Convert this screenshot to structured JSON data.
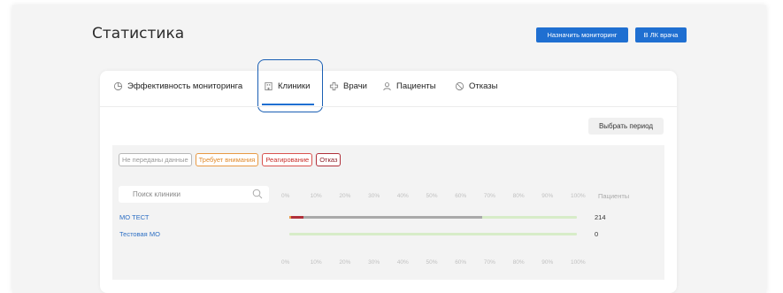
{
  "header": {
    "title": "Статистика",
    "assign_button": "Назначить мониторинг",
    "doctor_button": "В ЛК врача"
  },
  "tabs": [
    {
      "label": "Эффективность мониторинга",
      "icon": "chart-icon"
    },
    {
      "label": "Клиники",
      "icon": "building-icon",
      "active": true
    },
    {
      "label": "Врачи",
      "icon": "medical-cross-icon"
    },
    {
      "label": "Пациенты",
      "icon": "user-icon"
    },
    {
      "label": "Отказы",
      "icon": "cancel-icon"
    }
  ],
  "period_button": "Выбрать период",
  "legend": [
    {
      "label": "Не переданы данные",
      "color": "#b8b8b8"
    },
    {
      "label": "Требует внимания",
      "color": "#e89a45"
    },
    {
      "label": "Реагирование",
      "color": "#d9534f"
    },
    {
      "label": "Отказ",
      "color": "#b0303a"
    }
  ],
  "search": {
    "placeholder": "Поиск клиники"
  },
  "axis_ticks": [
    "0%",
    "10%",
    "20%",
    "30%",
    "40%",
    "50%",
    "60%",
    "70%",
    "80%",
    "90%",
    "100%"
  ],
  "patients_label": "Пациенты",
  "clinics": [
    {
      "name": "МО ТЕСТ",
      "patients": "214",
      "segments": [
        {
          "type": "Требует внимания",
          "share": 0.006,
          "color": "#e89a45"
        },
        {
          "type": "Реагирование",
          "share": 0.044,
          "color": "#b0303a"
        },
        {
          "type": "Не переданы данные",
          "share": 0.62,
          "color": "#a9a9a9"
        }
      ]
    },
    {
      "name": "Тестовая МО",
      "patients": "0",
      "segments": []
    }
  ],
  "colors": {
    "accent": "#1f6fd1",
    "bar_track": "#d7ecc8"
  }
}
